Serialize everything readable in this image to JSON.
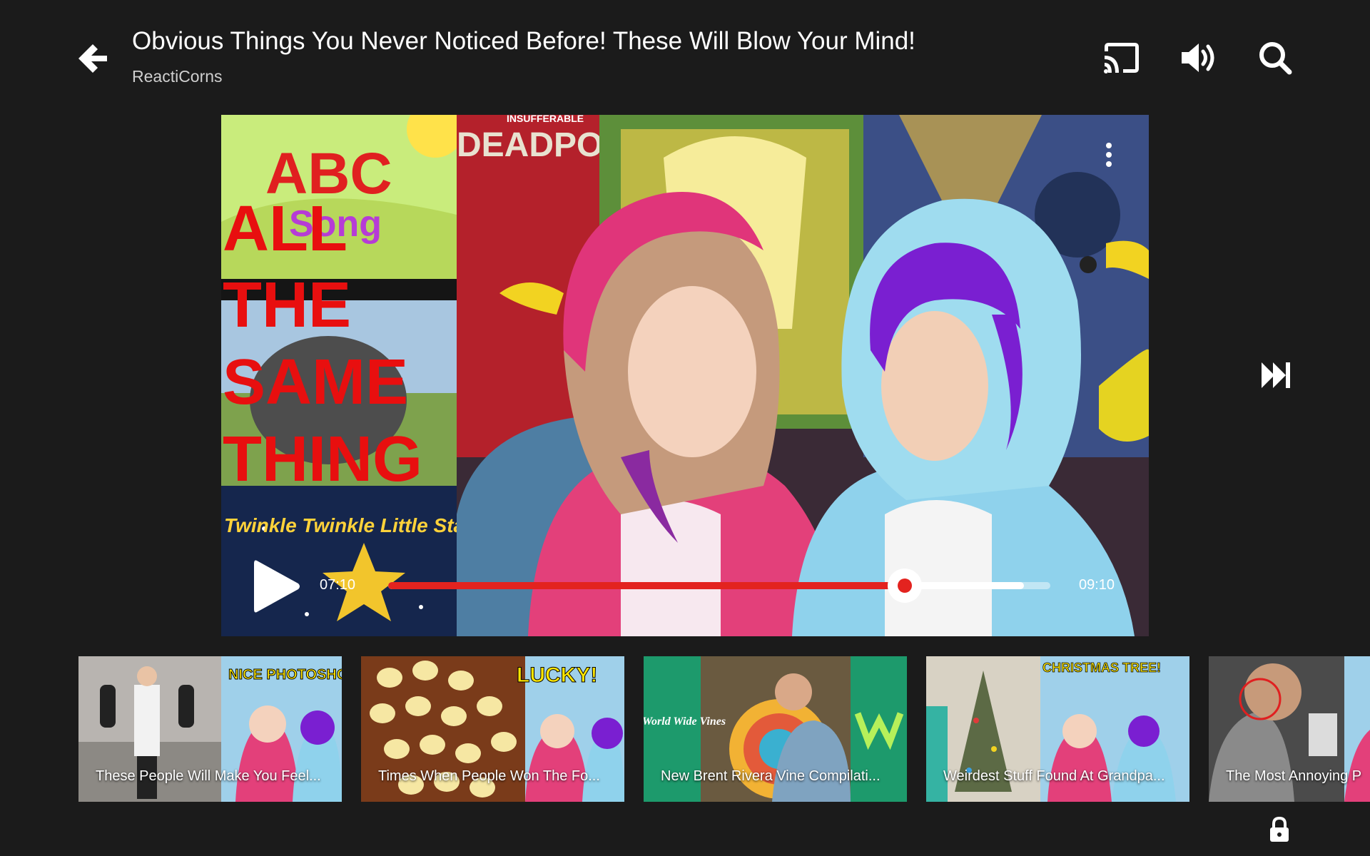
{
  "header": {
    "title": "Obvious Things You Never Noticed Before! These Will Blow Your Mind!",
    "channel": "ReactiCorns",
    "icons": [
      "back-arrow-icon",
      "cast-icon",
      "volume-icon",
      "search-icon"
    ]
  },
  "player": {
    "current_time": "07:10",
    "duration": "09:10",
    "progress_fraction": 0.78,
    "buffered_fraction": 0.96,
    "overlay_text": {
      "abc": "ABC",
      "song": "Song",
      "line1": "ALL",
      "line2": "THE",
      "line3": "SAME",
      "line4": "THING",
      "twinkle": "Twinkle Twinkle Little Star",
      "poster_top": "INSUFFERABLE",
      "poster_word": "DEADPOOL"
    },
    "accent_color": "#e3231f"
  },
  "related_videos": [
    {
      "title": "These People Will Make You Feel...",
      "badge": "NICE PHOTOSHOP!"
    },
    {
      "title": "Times When People Won The Fo...",
      "badge": "LUCKY!"
    },
    {
      "title": "New Brent Rivera Vine Compilati...",
      "badge": "World Wide Vines"
    },
    {
      "title": "Weirdest Stuff Found At Grandpa...",
      "badge": "CHRISTMAS TREE!"
    },
    {
      "title": "The Most Annoying P",
      "badge": ""
    }
  ]
}
